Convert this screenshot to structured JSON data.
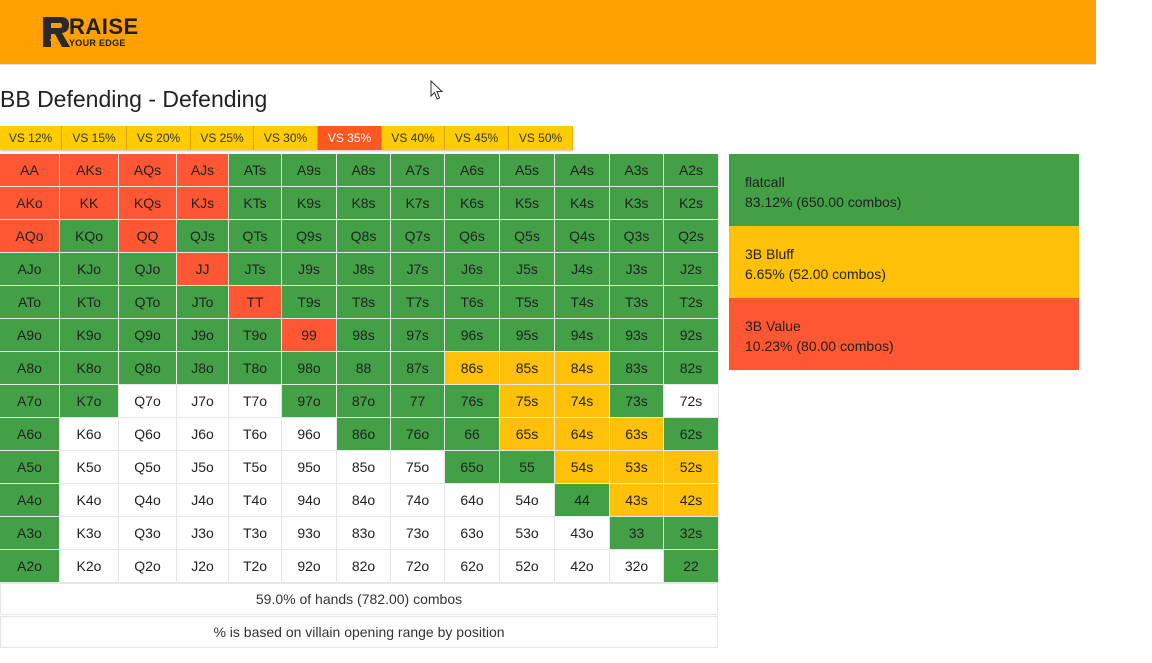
{
  "header": {
    "logo_big": "RAISE",
    "logo_small": "YOUR EDGE"
  },
  "page": {
    "title": "BB Defending - Defending"
  },
  "tabs": [
    {
      "label": "VS 12%",
      "active": false,
      "width": 62
    },
    {
      "label": "VS 15%",
      "active": false,
      "width": 65
    },
    {
      "label": "VS 20%",
      "active": false,
      "width": 64
    },
    {
      "label": "VS 25%",
      "active": false,
      "width": 63
    },
    {
      "label": "VS 30%",
      "active": false,
      "width": 64
    },
    {
      "label": "VS 35%",
      "active": true,
      "width": 64
    },
    {
      "label": "VS 40%",
      "active": false,
      "width": 63
    },
    {
      "label": "VS 45%",
      "active": false,
      "width": 64
    },
    {
      "label": "VS 50%",
      "active": false,
      "width": 64
    }
  ],
  "colors": {
    "flatcall": "#43a047",
    "bluff": "#ffc107",
    "value": "#ff5733",
    "none": "#ffffff",
    "header": "#ffa000",
    "tab": "#ffcc00",
    "tab_active": "#ff5722"
  },
  "grid": {
    "rows": [
      [
        [
          "AA",
          "r"
        ],
        [
          "AKs",
          "r"
        ],
        [
          "AQs",
          "r"
        ],
        [
          "AJs",
          "r"
        ],
        [
          "ATs",
          "g"
        ],
        [
          "A9s",
          "g"
        ],
        [
          "A8s",
          "g"
        ],
        [
          "A7s",
          "g"
        ],
        [
          "A6s",
          "g"
        ],
        [
          "A5s",
          "g"
        ],
        [
          "A4s",
          "g"
        ],
        [
          "A3s",
          "g"
        ],
        [
          "A2s",
          "g"
        ]
      ],
      [
        [
          "AKo",
          "r"
        ],
        [
          "KK",
          "r"
        ],
        [
          "KQs",
          "r"
        ],
        [
          "KJs",
          "r"
        ],
        [
          "KTs",
          "g"
        ],
        [
          "K9s",
          "g"
        ],
        [
          "K8s",
          "g"
        ],
        [
          "K7s",
          "g"
        ],
        [
          "K6s",
          "g"
        ],
        [
          "K5s",
          "g"
        ],
        [
          "K4s",
          "g"
        ],
        [
          "K3s",
          "g"
        ],
        [
          "K2s",
          "g"
        ]
      ],
      [
        [
          "AQo",
          "r"
        ],
        [
          "KQo",
          "g"
        ],
        [
          "QQ",
          "r"
        ],
        [
          "QJs",
          "g"
        ],
        [
          "QTs",
          "g"
        ],
        [
          "Q9s",
          "g"
        ],
        [
          "Q8s",
          "g"
        ],
        [
          "Q7s",
          "g"
        ],
        [
          "Q6s",
          "g"
        ],
        [
          "Q5s",
          "g"
        ],
        [
          "Q4s",
          "g"
        ],
        [
          "Q3s",
          "g"
        ],
        [
          "Q2s",
          "g"
        ]
      ],
      [
        [
          "AJo",
          "g"
        ],
        [
          "KJo",
          "g"
        ],
        [
          "QJo",
          "g"
        ],
        [
          "JJ",
          "r"
        ],
        [
          "JTs",
          "g"
        ],
        [
          "J9s",
          "g"
        ],
        [
          "J8s",
          "g"
        ],
        [
          "J7s",
          "g"
        ],
        [
          "J6s",
          "g"
        ],
        [
          "J5s",
          "g"
        ],
        [
          "J4s",
          "g"
        ],
        [
          "J3s",
          "g"
        ],
        [
          "J2s",
          "g"
        ]
      ],
      [
        [
          "ATo",
          "g"
        ],
        [
          "KTo",
          "g"
        ],
        [
          "QTo",
          "g"
        ],
        [
          "JTo",
          "g"
        ],
        [
          "TT",
          "r"
        ],
        [
          "T9s",
          "g"
        ],
        [
          "T8s",
          "g"
        ],
        [
          "T7s",
          "g"
        ],
        [
          "T6s",
          "g"
        ],
        [
          "T5s",
          "g"
        ],
        [
          "T4s",
          "g"
        ],
        [
          "T3s",
          "g"
        ],
        [
          "T2s",
          "g"
        ]
      ],
      [
        [
          "A9o",
          "g"
        ],
        [
          "K9o",
          "g"
        ],
        [
          "Q9o",
          "g"
        ],
        [
          "J9o",
          "g"
        ],
        [
          "T9o",
          "g"
        ],
        [
          "99",
          "r"
        ],
        [
          "98s",
          "g"
        ],
        [
          "97s",
          "g"
        ],
        [
          "96s",
          "g"
        ],
        [
          "95s",
          "g"
        ],
        [
          "94s",
          "g"
        ],
        [
          "93s",
          "g"
        ],
        [
          "92s",
          "g"
        ]
      ],
      [
        [
          "A8o",
          "g"
        ],
        [
          "K8o",
          "g"
        ],
        [
          "Q8o",
          "g"
        ],
        [
          "J8o",
          "g"
        ],
        [
          "T8o",
          "g"
        ],
        [
          "98o",
          "g"
        ],
        [
          "88",
          "g"
        ],
        [
          "87s",
          "g"
        ],
        [
          "86s",
          "y"
        ],
        [
          "85s",
          "y"
        ],
        [
          "84s",
          "y"
        ],
        [
          "83s",
          "g"
        ],
        [
          "82s",
          "g"
        ]
      ],
      [
        [
          "A7o",
          "g"
        ],
        [
          "K7o",
          "g"
        ],
        [
          "Q7o",
          "w"
        ],
        [
          "J7o",
          "w"
        ],
        [
          "T7o",
          "w"
        ],
        [
          "97o",
          "g"
        ],
        [
          "87o",
          "g"
        ],
        [
          "77",
          "g"
        ],
        [
          "76s",
          "g"
        ],
        [
          "75s",
          "y"
        ],
        [
          "74s",
          "y"
        ],
        [
          "73s",
          "g"
        ],
        [
          "72s",
          "w"
        ]
      ],
      [
        [
          "A6o",
          "g"
        ],
        [
          "K6o",
          "w"
        ],
        [
          "Q6o",
          "w"
        ],
        [
          "J6o",
          "w"
        ],
        [
          "T6o",
          "w"
        ],
        [
          "96o",
          "w"
        ],
        [
          "86o",
          "g"
        ],
        [
          "76o",
          "g"
        ],
        [
          "66",
          "g"
        ],
        [
          "65s",
          "y"
        ],
        [
          "64s",
          "y"
        ],
        [
          "63s",
          "y"
        ],
        [
          "62s",
          "g"
        ]
      ],
      [
        [
          "A5o",
          "g"
        ],
        [
          "K5o",
          "w"
        ],
        [
          "Q5o",
          "w"
        ],
        [
          "J5o",
          "w"
        ],
        [
          "T5o",
          "w"
        ],
        [
          "95o",
          "w"
        ],
        [
          "85o",
          "w"
        ],
        [
          "75o",
          "w"
        ],
        [
          "65o",
          "g"
        ],
        [
          "55",
          "g"
        ],
        [
          "54s",
          "y"
        ],
        [
          "53s",
          "y"
        ],
        [
          "52s",
          "y"
        ]
      ],
      [
        [
          "A4o",
          "g"
        ],
        [
          "K4o",
          "w"
        ],
        [
          "Q4o",
          "w"
        ],
        [
          "J4o",
          "w"
        ],
        [
          "T4o",
          "w"
        ],
        [
          "94o",
          "w"
        ],
        [
          "84o",
          "w"
        ],
        [
          "74o",
          "w"
        ],
        [
          "64o",
          "w"
        ],
        [
          "54o",
          "w"
        ],
        [
          "44",
          "g"
        ],
        [
          "43s",
          "y"
        ],
        [
          "42s",
          "y"
        ]
      ],
      [
        [
          "A3o",
          "g"
        ],
        [
          "K3o",
          "w"
        ],
        [
          "Q3o",
          "w"
        ],
        [
          "J3o",
          "w"
        ],
        [
          "T3o",
          "w"
        ],
        [
          "93o",
          "w"
        ],
        [
          "83o",
          "w"
        ],
        [
          "73o",
          "w"
        ],
        [
          "63o",
          "w"
        ],
        [
          "53o",
          "w"
        ],
        [
          "43o",
          "w"
        ],
        [
          "33",
          "g"
        ],
        [
          "32s",
          "g"
        ]
      ],
      [
        [
          "A2o",
          "g"
        ],
        [
          "K2o",
          "w"
        ],
        [
          "Q2o",
          "w"
        ],
        [
          "J2o",
          "w"
        ],
        [
          "T2o",
          "w"
        ],
        [
          "92o",
          "w"
        ],
        [
          "82o",
          "w"
        ],
        [
          "72o",
          "w"
        ],
        [
          "62o",
          "w"
        ],
        [
          "52o",
          "w"
        ],
        [
          "42o",
          "w"
        ],
        [
          "32o",
          "w"
        ],
        [
          "22",
          "g"
        ]
      ]
    ]
  },
  "summary": {
    "hands": "59.0% of hands (782.00) combos",
    "note": "% is based on villain opening range by position"
  },
  "legend": [
    {
      "key": "flatcall",
      "name": "flatcall",
      "stat": "83.12% (650.00 combos)"
    },
    {
      "key": "bluff",
      "name": "3B Bluff",
      "stat": "6.65% (52.00 combos)"
    },
    {
      "key": "value",
      "name": "3B Value",
      "stat": "10.23% (80.00 combos)"
    }
  ]
}
